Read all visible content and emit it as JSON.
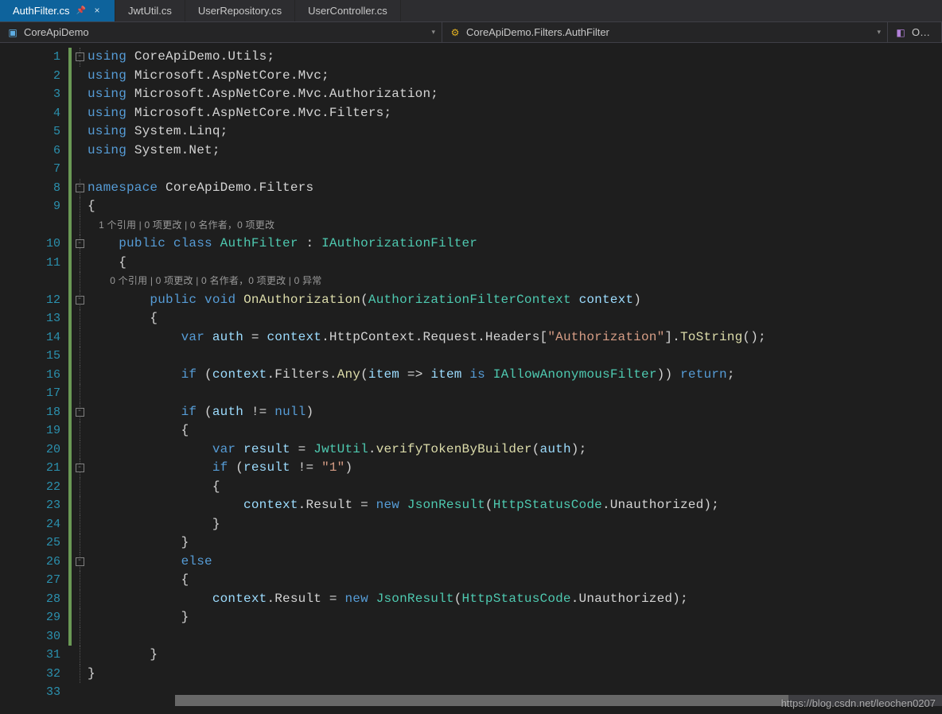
{
  "tabs": [
    {
      "label": "AuthFilter.cs",
      "active": true,
      "pinned": true
    },
    {
      "label": "JwtUtil.cs",
      "active": false,
      "pinned": false
    },
    {
      "label": "UserRepository.cs",
      "active": false,
      "pinned": false
    },
    {
      "label": "UserController.cs",
      "active": false,
      "pinned": false
    }
  ],
  "nav": {
    "project": "CoreApiDemo",
    "class": "CoreApiDemo.Filters.AuthFilter",
    "member": "OnAu"
  },
  "codelens": {
    "cls": "1 个引用 | 0 项更改 | 0 名作者，0 项更改",
    "meth": "0 个引用 | 0 项更改 | 0 名作者，0 项更改 | 0 异常"
  },
  "lines": [
    {
      "n": 1,
      "mod": true,
      "fold": "box",
      "tokens": [
        [
          "k",
          "using "
        ],
        [
          "ns",
          "CoreApiDemo.Utils;"
        ]
      ]
    },
    {
      "n": 2,
      "mod": true,
      "tokens": [
        [
          "k",
          "using "
        ],
        [
          "ns",
          "Microsoft.AspNetCore.Mvc;"
        ]
      ]
    },
    {
      "n": 3,
      "mod": true,
      "tokens": [
        [
          "k",
          "using "
        ],
        [
          "ns",
          "Microsoft.AspNetCore.Mvc.Authorization;"
        ]
      ]
    },
    {
      "n": 4,
      "mod": true,
      "tokens": [
        [
          "k",
          "using "
        ],
        [
          "ns",
          "Microsoft.AspNetCore.Mvc.Filters;"
        ]
      ]
    },
    {
      "n": 5,
      "mod": true,
      "tokens": [
        [
          "k",
          "using "
        ],
        [
          "ns",
          "System.Linq;"
        ]
      ]
    },
    {
      "n": 6,
      "mod": true,
      "tokens": [
        [
          "k",
          "using "
        ],
        [
          "ns",
          "System.Net;"
        ]
      ]
    },
    {
      "n": 7,
      "mod": true,
      "tokens": []
    },
    {
      "n": 8,
      "mod": true,
      "fold": "box",
      "tokens": [
        [
          "k",
          "namespace "
        ],
        [
          "ns",
          "CoreApiDemo.Filters"
        ]
      ]
    },
    {
      "n": 9,
      "mod": true,
      "fold": "line",
      "tokens": [
        [
          "p",
          "{"
        ]
      ]
    },
    {
      "n": null,
      "codelens": "cls",
      "mod": true,
      "fold": "line",
      "indent": 4
    },
    {
      "n": 10,
      "mod": true,
      "fold": "box",
      "tokens": [
        [
          "p",
          "    "
        ],
        [
          "k",
          "public class "
        ],
        [
          "t",
          "AuthFilter"
        ],
        [
          "p",
          " : "
        ],
        [
          "t",
          "IAuthorizationFilter"
        ]
      ]
    },
    {
      "n": 11,
      "mod": true,
      "fold": "line",
      "tokens": [
        [
          "p",
          "    {"
        ]
      ]
    },
    {
      "n": null,
      "codelens": "meth",
      "mod": true,
      "fold": "line",
      "indent": 8
    },
    {
      "n": 12,
      "mod": true,
      "fold": "box",
      "tokens": [
        [
          "p",
          "        "
        ],
        [
          "k",
          "public "
        ],
        [
          "k",
          "void "
        ],
        [
          "m",
          "OnAuthorization"
        ],
        [
          "p",
          "("
        ],
        [
          "t",
          "AuthorizationFilterContext"
        ],
        [
          "p",
          " "
        ],
        [
          "v",
          "context"
        ],
        [
          "p",
          ")"
        ]
      ]
    },
    {
      "n": 13,
      "mod": true,
      "fold": "line",
      "tokens": [
        [
          "p",
          "        {"
        ]
      ]
    },
    {
      "n": 14,
      "mod": true,
      "fold": "line",
      "tokens": [
        [
          "p",
          "            "
        ],
        [
          "k",
          "var "
        ],
        [
          "v",
          "auth"
        ],
        [
          "p",
          " = "
        ],
        [
          "v",
          "context"
        ],
        [
          "p",
          ".HttpContext.Request.Headers["
        ],
        [
          "s",
          "\"Authorization\""
        ],
        [
          "p",
          "]."
        ],
        [
          "m",
          "ToString"
        ],
        [
          "p",
          "();"
        ]
      ]
    },
    {
      "n": 15,
      "mod": true,
      "fold": "line",
      "tokens": []
    },
    {
      "n": 16,
      "mod": true,
      "fold": "line",
      "tokens": [
        [
          "p",
          "            "
        ],
        [
          "k",
          "if"
        ],
        [
          "p",
          " ("
        ],
        [
          "v",
          "context"
        ],
        [
          "p",
          ".Filters."
        ],
        [
          "m",
          "Any"
        ],
        [
          "p",
          "("
        ],
        [
          "v",
          "item"
        ],
        [
          "p",
          " => "
        ],
        [
          "v",
          "item"
        ],
        [
          "p",
          " "
        ],
        [
          "k",
          "is"
        ],
        [
          "p",
          " "
        ],
        [
          "t",
          "IAllowAnonymousFilter"
        ],
        [
          "p",
          ")) "
        ],
        [
          "k",
          "return"
        ],
        [
          "p",
          ";"
        ]
      ]
    },
    {
      "n": 17,
      "mod": true,
      "fold": "line",
      "tokens": []
    },
    {
      "n": 18,
      "mod": true,
      "fold": "box",
      "tokens": [
        [
          "p",
          "            "
        ],
        [
          "k",
          "if"
        ],
        [
          "p",
          " ("
        ],
        [
          "v",
          "auth"
        ],
        [
          "p",
          " != "
        ],
        [
          "k",
          "null"
        ],
        [
          "p",
          ")"
        ]
      ]
    },
    {
      "n": 19,
      "mod": true,
      "fold": "line",
      "tokens": [
        [
          "p",
          "            {"
        ]
      ]
    },
    {
      "n": 20,
      "mod": true,
      "fold": "line",
      "tokens": [
        [
          "p",
          "                "
        ],
        [
          "k",
          "var "
        ],
        [
          "v",
          "result"
        ],
        [
          "p",
          " = "
        ],
        [
          "t",
          "JwtUtil"
        ],
        [
          "p",
          "."
        ],
        [
          "m",
          "verifyTokenByBuilder"
        ],
        [
          "p",
          "("
        ],
        [
          "v",
          "auth"
        ],
        [
          "p",
          ");"
        ]
      ]
    },
    {
      "n": 21,
      "mod": true,
      "fold": "box",
      "tokens": [
        [
          "p",
          "                "
        ],
        [
          "k",
          "if"
        ],
        [
          "p",
          " ("
        ],
        [
          "v",
          "result"
        ],
        [
          "p",
          " != "
        ],
        [
          "s",
          "\"1\""
        ],
        [
          "p",
          ")"
        ]
      ]
    },
    {
      "n": 22,
      "mod": true,
      "fold": "line",
      "tokens": [
        [
          "p",
          "                {"
        ]
      ]
    },
    {
      "n": 23,
      "mod": true,
      "fold": "line",
      "tokens": [
        [
          "p",
          "                    "
        ],
        [
          "v",
          "context"
        ],
        [
          "p",
          ".Result = "
        ],
        [
          "k",
          "new "
        ],
        [
          "t",
          "JsonResult"
        ],
        [
          "p",
          "("
        ],
        [
          "t",
          "HttpStatusCode"
        ],
        [
          "p",
          ".Unauthorized);"
        ]
      ]
    },
    {
      "n": 24,
      "mod": true,
      "fold": "line",
      "tokens": [
        [
          "p",
          "                }"
        ]
      ]
    },
    {
      "n": 25,
      "mod": true,
      "fold": "line",
      "tokens": [
        [
          "p",
          "            }"
        ]
      ]
    },
    {
      "n": 26,
      "mod": true,
      "fold": "box",
      "tokens": [
        [
          "p",
          "            "
        ],
        [
          "k",
          "else"
        ]
      ]
    },
    {
      "n": 27,
      "mod": true,
      "fold": "line",
      "tokens": [
        [
          "p",
          "            {"
        ]
      ]
    },
    {
      "n": 28,
      "mod": true,
      "fold": "line",
      "tokens": [
        [
          "p",
          "                "
        ],
        [
          "v",
          "context"
        ],
        [
          "p",
          ".Result = "
        ],
        [
          "k",
          "new "
        ],
        [
          "t",
          "JsonResult"
        ],
        [
          "p",
          "("
        ],
        [
          "t",
          "HttpStatusCode"
        ],
        [
          "p",
          ".Unauthorized);"
        ]
      ]
    },
    {
      "n": 29,
      "mod": true,
      "fold": "line",
      "tokens": [
        [
          "p",
          "            }"
        ]
      ]
    },
    {
      "n": 30,
      "mod": true,
      "fold": "line",
      "tokens": []
    },
    {
      "n": 31,
      "mod": false,
      "fold": "line",
      "tokens": [
        [
          "p",
          "        }"
        ]
      ]
    },
    {
      "n": 32,
      "mod": false,
      "fold": "line",
      "tokens": [
        [
          "p",
          "}"
        ]
      ]
    },
    {
      "n": 33,
      "mod": false,
      "tokens": []
    }
  ],
  "watermark": "https://blog.csdn.net/leochen0207"
}
